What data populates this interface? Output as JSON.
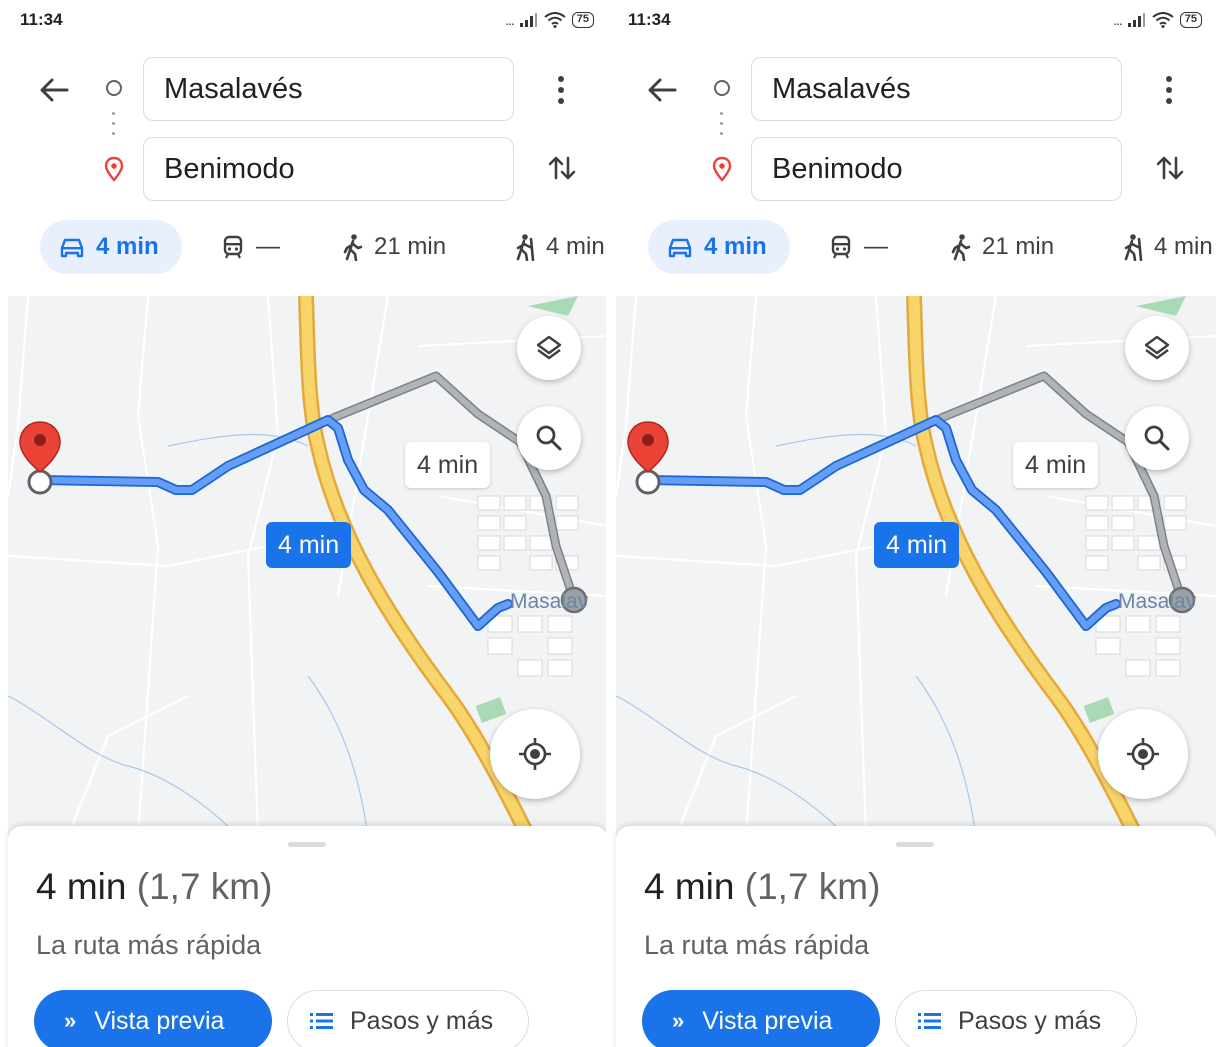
{
  "status_bar": {
    "time": "11:34",
    "signal": "...",
    "battery": "75"
  },
  "route": {
    "origin": "Masalavés",
    "destination": "Benimodo"
  },
  "modes": {
    "drive": "4 min",
    "transit": "—",
    "walk": "21 min",
    "ride": "4 min"
  },
  "map": {
    "alt_route_time": "4 min",
    "main_route_time": "4 min",
    "place_label": "Masalav"
  },
  "sheet": {
    "duration": "4 min",
    "distance": "(1,7 km)",
    "subtitle": "La ruta más rápida",
    "preview_button": "Vista previa",
    "steps_button": "Pasos y más"
  },
  "colors": {
    "accent": "#1a73e8",
    "route_main": "#4285f4",
    "route_alt": "#9aa0a6",
    "highway": "#f6c343",
    "pin": "#ea4335"
  },
  "icons": [
    "back-arrow-icon",
    "origin-circle-icon",
    "destination-pin-icon",
    "more-vert-icon",
    "swap-icon",
    "car-icon",
    "train-icon",
    "walk-icon",
    "ride-icon",
    "layers-icon",
    "search-icon",
    "my-location-icon",
    "chevron-double-right-icon",
    "list-icon"
  ]
}
